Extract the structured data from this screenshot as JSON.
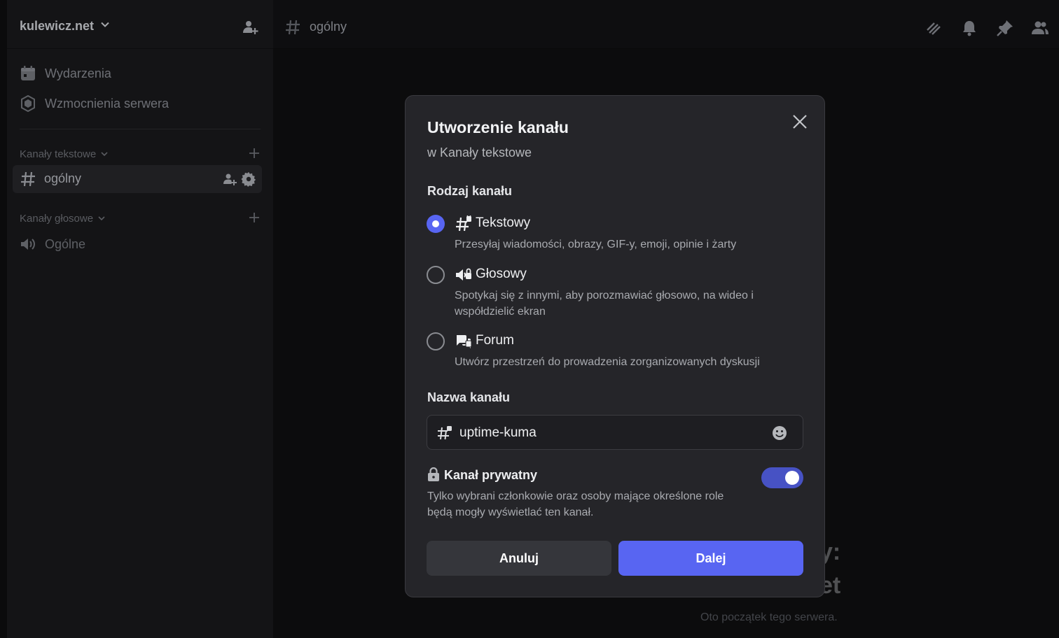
{
  "server": {
    "name": "kulewicz.net"
  },
  "sidebar": {
    "nav": [
      {
        "label": "Wydarzenia",
        "icon": "calendar-icon"
      },
      {
        "label": "Wzmocnienia serwera",
        "icon": "boost-icon"
      }
    ],
    "categories": {
      "text": "Kanały tekstowe",
      "voice": "Kanały głosowe"
    },
    "text_channels": [
      {
        "name": "ogólny"
      }
    ],
    "voice_channels": [
      {
        "name": "Ogólne"
      }
    ]
  },
  "topbar": {
    "channel": "ogólny"
  },
  "welcome": {
    "line1_fragment": "y:",
    "line2_fragment": "et",
    "subtitle": "Oto początek tego serwera."
  },
  "modal": {
    "title": "Utworzenie kanału",
    "subtitle": "w Kanały tekstowe",
    "type_label": "Rodzaj kanału",
    "options": [
      {
        "name": "Tekstowy",
        "desc": "Przesyłaj wiadomości, obrazy, GIF-y, emoji, opinie i żarty",
        "selected": true
      },
      {
        "name": "Głosowy",
        "desc": "Spotykaj się z innymi, aby porozmawiać głosowo, na wideo i współdzielić ekran",
        "selected": false
      },
      {
        "name": "Forum",
        "desc": "Utwórz przestrzeń do prowadzenia zorganizowanych dyskusji",
        "selected": false
      }
    ],
    "name_label": "Nazwa kanału",
    "name_value": "uptime-kuma",
    "private": {
      "label": "Kanał prywatny",
      "desc": "Tylko wybrani członkowie oraz osoby mające określone role będą mogły wyświetlać ten kanał.",
      "enabled": true
    },
    "cancel_label": "Anuluj",
    "next_label": "Dalej"
  },
  "colors": {
    "accent": "#5865f2",
    "toggle_on": "#4752c4",
    "modal_bg": "#252529"
  }
}
